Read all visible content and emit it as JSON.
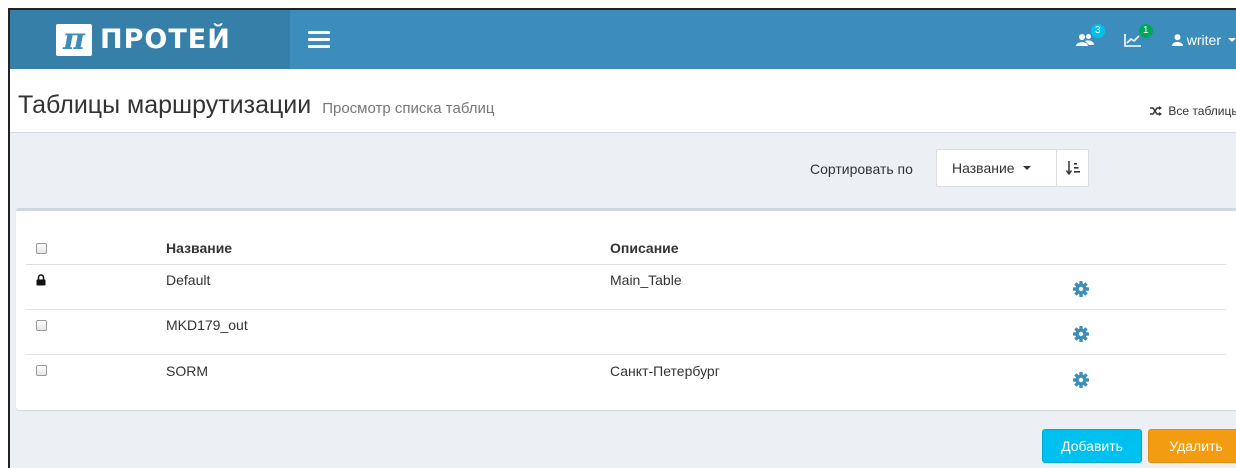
{
  "app": {
    "logo_symbol": "π",
    "logo_text": "ПРОТЕЙ"
  },
  "navbar": {
    "users_badge": "3",
    "stats_badge": "1",
    "user_name": "writer"
  },
  "header": {
    "title": "Таблицы маршрутизации",
    "subtitle": "Просмотр списка таблиц",
    "all_tables_link": "Все таблицы"
  },
  "sort": {
    "label": "Сортировать по",
    "selected": "Название"
  },
  "table": {
    "columns": {
      "name": "Название",
      "description": "Описание"
    },
    "rows": [
      {
        "name": "Default",
        "description": "Main_Table",
        "locked": true
      },
      {
        "name": "MKD179_out",
        "description": "",
        "locked": false
      },
      {
        "name": "SORM",
        "description": "Санкт-Петербург",
        "locked": false
      }
    ]
  },
  "actions": {
    "add_label": "Добавить",
    "delete_label": "Удалить"
  },
  "colors": {
    "navbar": "#3c8dbc",
    "logo_bg": "#367fa9",
    "add_button": "#00c0ef",
    "delete_button": "#f39c12",
    "gear": "#3c8dbc"
  }
}
